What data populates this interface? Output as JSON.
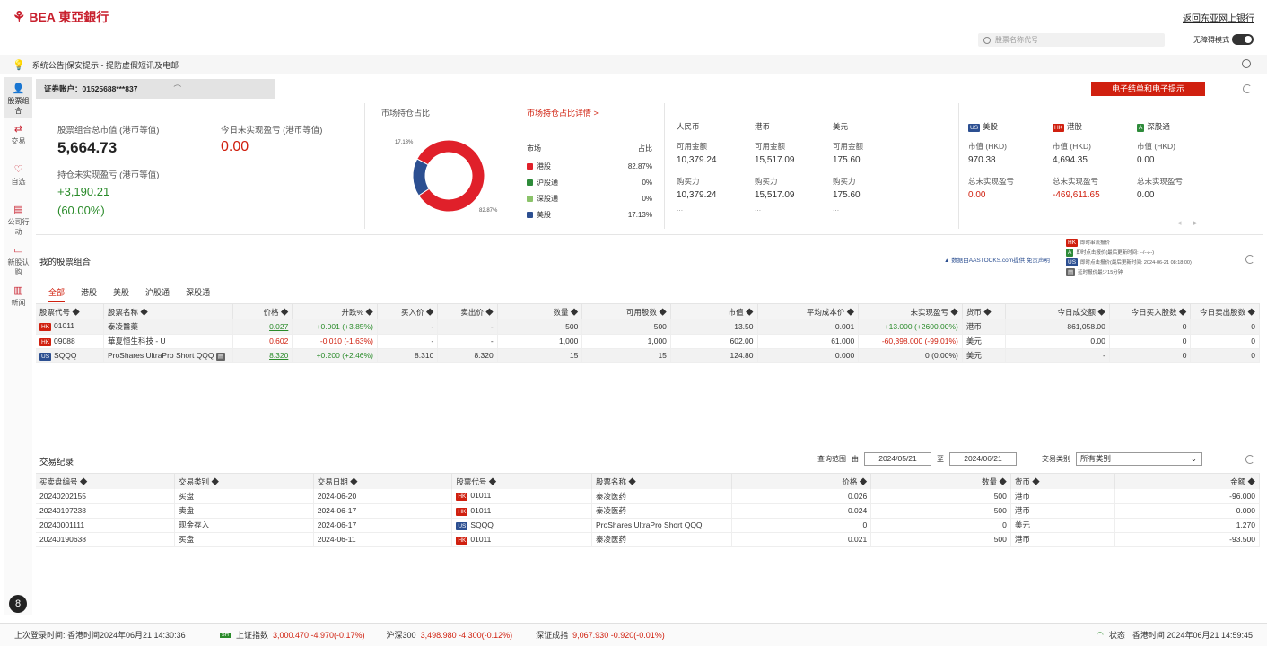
{
  "header": {
    "logo_text": "BEA 東亞銀行",
    "back_link": "返回东亚网上银行",
    "search_placeholder": "股票名称代号",
    "accessibility_label": "无障碍模式"
  },
  "notice": {
    "text": "系统公告|保安提示 - 提防虚假短讯及电邮"
  },
  "sidebar": {
    "items": [
      {
        "label": "股票组合",
        "icon": "person-icon"
      },
      {
        "label": "交易",
        "icon": "exchange-icon"
      },
      {
        "label": "自选",
        "icon": "heart-icon"
      },
      {
        "label": "公司行动",
        "icon": "document-icon"
      },
      {
        "label": "新股认购",
        "icon": "ipo-icon"
      },
      {
        "label": "新闻",
        "icon": "news-icon"
      }
    ]
  },
  "account": {
    "label": "证券账户：01525688***837",
    "estatement_button": "电子结单和电子提示"
  },
  "summary": {
    "total_value_label": "股票组合总市值 (港币等值)",
    "total_value": "5,664.73",
    "today_pl_label": "今日未实现盈亏 (港币等值)",
    "today_pl": "0.00",
    "holding_pl_label": "持仓未实现盈亏 (港币等值)",
    "holding_pl": "+3,190.21",
    "holding_pl_pct": "(60.00%)",
    "market_share_title": "市场持仓占比",
    "market_share_link": "市场持仓占比详情 >",
    "pie_label_small": "17.13%",
    "pie_label_big": "82.87%",
    "legend_headers": [
      "市场",
      "占比"
    ],
    "legend": [
      {
        "name": "港股",
        "value": "82.87%",
        "color": "#e0202a"
      },
      {
        "name": "沪股通",
        "value": "0%",
        "color": "#2e8b3a"
      },
      {
        "name": "深股通",
        "value": "0%",
        "color": "#8bc36a"
      },
      {
        "name": "美股",
        "value": "17.13%",
        "color": "#2c4f91"
      }
    ],
    "currencies": [
      {
        "name": "人民币",
        "avail_label": "可用金额",
        "avail": "10,379.24",
        "buy_label": "购买力",
        "buy": "10,379.24",
        "more": "..."
      },
      {
        "name": "港币",
        "avail_label": "可用金额",
        "avail": "15,517.09",
        "buy_label": "购买力",
        "buy": "15,517.09",
        "more": "..."
      },
      {
        "name": "美元",
        "avail_label": "可用金额",
        "avail": "175.60",
        "buy_label": "购买力",
        "buy": "175.60",
        "more": "..."
      }
    ],
    "markets": [
      {
        "badge": "US",
        "badge_color": "#2c4f91",
        "name": "美股",
        "mv_label": "市值 (HKD)",
        "mv": "970.38",
        "pl_label": "总未实现盈亏",
        "pl": "0.00",
        "pl_color": "#d0200f"
      },
      {
        "badge": "HK",
        "badge_color": "#d0200f",
        "name": "港股",
        "mv_label": "市值 (HKD)",
        "mv": "4,694.35",
        "pl_label": "总未实现盈亏",
        "pl": "-469,611.65",
        "pl_color": "#d0200f"
      },
      {
        "badge": "A",
        "badge_color": "#2e8b3a",
        "name": "深股通",
        "mv_label": "市值 (HKD)",
        "mv": "0.00",
        "pl_label": "总未实现盈亏",
        "pl": "0.00",
        "pl_color": "#333333"
      }
    ]
  },
  "portfolio": {
    "title": "我的股票组合",
    "source": "数据由AASTOCKS.com提供 免责声明",
    "quote_notes": [
      "即时串流报价",
      "即时点击报价(最后更新时间: --/--/--)",
      "即时点击报价(最后更新时间: 2024-06-21 08:18:00)",
      "延时报价最少15分钟"
    ],
    "tabs": [
      "全部",
      "港股",
      "美股",
      "沪股通",
      "深股通"
    ],
    "columns": [
      "股票代号 ◆",
      "股票名称 ◆",
      "价格 ◆",
      "升跌% ◆",
      "买入价 ◆",
      "卖出价 ◆",
      "数量 ◆",
      "可用股数 ◆",
      "市值 ◆",
      "平均成本价 ◆",
      "未实现盈亏 ◆",
      "货币 ◆",
      "今日成交额 ◆",
      "今日买入股数 ◆",
      "今日卖出股数 ◆"
    ],
    "rows": [
      {
        "badge": "HK",
        "code": "01011",
        "name": "泰凌醫藥",
        "price": "0.027",
        "change": "+0.001 (+3.85%)",
        "bid": "-",
        "ask": "-",
        "qty": "500",
        "avail": "500",
        "mv": "13.50",
        "avg": "0.001",
        "pl": "+13.000 (+2600.00%)",
        "ccy": "港币",
        "turnover": "861,058.00",
        "buy": "0",
        "sell": "0"
      },
      {
        "badge": "HK",
        "code": "09088",
        "name": "華夏恒生科技 - U",
        "price": "0.602",
        "change": "-0.010 (-1.63%)",
        "bid": "-",
        "ask": "-",
        "qty": "1,000",
        "avail": "1,000",
        "mv": "602.00",
        "avg": "61.000",
        "pl": "-60,398.000 (-99.01%)",
        "ccy": "美元",
        "turnover": "0.00",
        "buy": "0",
        "sell": "0"
      },
      {
        "badge": "US",
        "code": "SQQQ",
        "name": "ProShares UltraPro Short QQQ",
        "price": "8.320",
        "change": "+0.200 (+2.46%)",
        "bid": "8.310",
        "ask": "8.320",
        "qty": "15",
        "avail": "15",
        "mv": "124.80",
        "avg": "0.000",
        "pl": "0 (0.00%)",
        "ccy": "美元",
        "turnover": "-",
        "buy": "0",
        "sell": "0"
      }
    ]
  },
  "trades": {
    "title": "交易纪录",
    "range_label": "查询范围",
    "from_label": "由",
    "from": "2024/05/21",
    "to_label": "至",
    "to": "2024/06/21",
    "type_label": "交易类别",
    "type_value": "所有类别",
    "columns": [
      "买卖盘编号 ◆",
      "交易类别 ◆",
      "交易日期 ◆",
      "股票代号 ◆",
      "股票名称 ◆",
      "价格 ◆",
      "数量 ◆",
      "货币 ◆",
      "金额 ◆"
    ],
    "rows": [
      {
        "no": "20240202155",
        "type": "买盘",
        "date": "2024-06-20",
        "badge": "HK",
        "code": "01011",
        "name": "泰凌医药",
        "price": "0.026",
        "qty": "500",
        "ccy": "港币",
        "amt": "-96.000"
      },
      {
        "no": "20240197238",
        "type": "卖盘",
        "date": "2024-06-17",
        "badge": "HK",
        "code": "01011",
        "name": "泰凌医药",
        "price": "0.024",
        "qty": "500",
        "ccy": "港币",
        "amt": "0.000"
      },
      {
        "no": "20240001111",
        "type": "现金存入",
        "date": "2024-06-17",
        "badge": "US",
        "code": "SQQQ",
        "name": "ProShares UltraPro Short QQQ",
        "price": "0",
        "qty": "0",
        "ccy": "美元",
        "amt": "1.270"
      },
      {
        "no": "20240190638",
        "type": "买盘",
        "date": "2024-06-11",
        "badge": "HK",
        "code": "01011",
        "name": "泰凌医药",
        "price": "0.021",
        "qty": "500",
        "ccy": "港币",
        "amt": "-93.500"
      }
    ]
  },
  "footer": {
    "last_login": "上次登录时间: 香港时间2024年06月21 14:30:36",
    "sh_label": "上证指数",
    "sh_value": "3,000.470 -4.970(-0.17%)",
    "hs300_label": "沪深300",
    "hs300_value": "3,498.980 -4.300(-0.12%)",
    "sz_label": "深证成指",
    "sz_value": "9,067.930 -0.920(-0.01%)",
    "status_label": "状态",
    "status_time": "香港时间 2024年06月21 14:59:45"
  }
}
